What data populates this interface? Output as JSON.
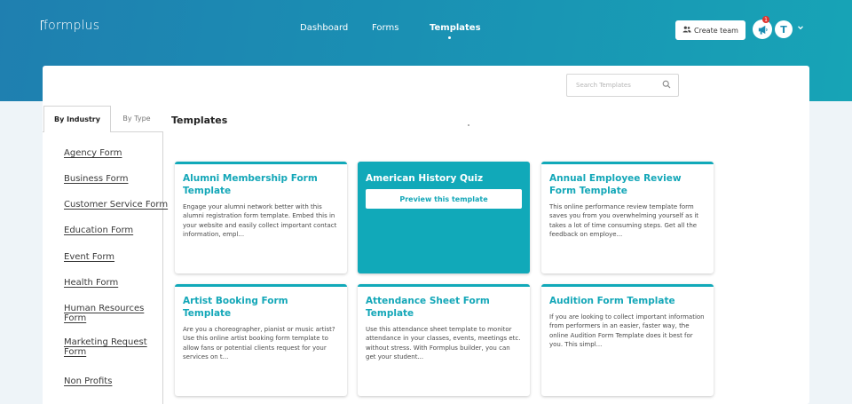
{
  "brand": {
    "logo_text": "formplus"
  },
  "nav": {
    "dashboard": "Dashboard",
    "forms": "Forms",
    "templates": "Templates",
    "active": "Templates"
  },
  "header": {
    "create_team_label": "Create team",
    "notification_count": "1",
    "avatar_initial": "T"
  },
  "search": {
    "placeholder": "Search Templates"
  },
  "tabs": {
    "by_industry": "By Industry",
    "by_type": "By Type",
    "active": "By Industry"
  },
  "categories": [
    "Agency Form",
    "Business Form",
    "Customer Service Form",
    "Education Form",
    "Event Form",
    "Health Form",
    "Human Resources Form",
    "Marketing Request Form",
    "Non Profits"
  ],
  "main": {
    "section_title": "Templates",
    "preview_label": "Preview this template"
  },
  "templates": [
    {
      "title": "Alumni Membership Form Template",
      "description": "Engage your alumni network better with this alumni registration form template. Embed this in your website and easily collect important contact information, empl..."
    },
    {
      "title": "American History Quiz",
      "description": ""
    },
    {
      "title": "Annual Employee Review Form Template",
      "description": "This online performance review template form saves you from you overwhelming yourself as it takes a lot of time consuming steps. Get all the feedback on employe..."
    },
    {
      "title": "Artist Booking Form Template",
      "description": "Are you a choreographer, pianist or music artist? Use this online artist booking form template to allow fans or potential clients request for your services on t..."
    },
    {
      "title": "Attendance Sheet Form Template",
      "description": "Use this attendance sheet template to monitor attendance in your classes, events, meetings etc. without stress. With Formplus builder, you can get your student..."
    },
    {
      "title": "Audition Form Template",
      "description": "If you are looking to collect important information from performers in an easier, faster way, the online Audition Form Template does it best for you. This simpl..."
    }
  ],
  "colors": {
    "accent": "#11a9b9",
    "header_start": "#1f7fb0",
    "header_end": "#17a4b6",
    "badge": "#e0342e"
  },
  "icons": {
    "create_team": "users-icon",
    "notifications": "megaphone-icon",
    "search": "search-icon",
    "avatar_menu": "chevron-down-icon"
  }
}
